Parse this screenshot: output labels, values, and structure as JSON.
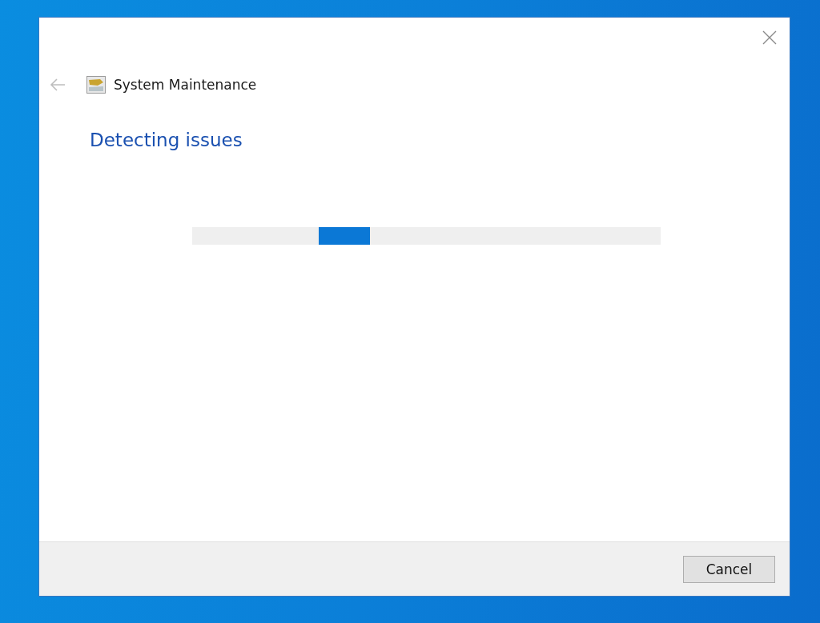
{
  "window": {
    "title": "System Maintenance",
    "back_disabled": true
  },
  "heading": "Detecting issues",
  "progress": {
    "kind": "indeterminate"
  },
  "buttons": [
    {
      "label": "Cancel"
    }
  ]
}
